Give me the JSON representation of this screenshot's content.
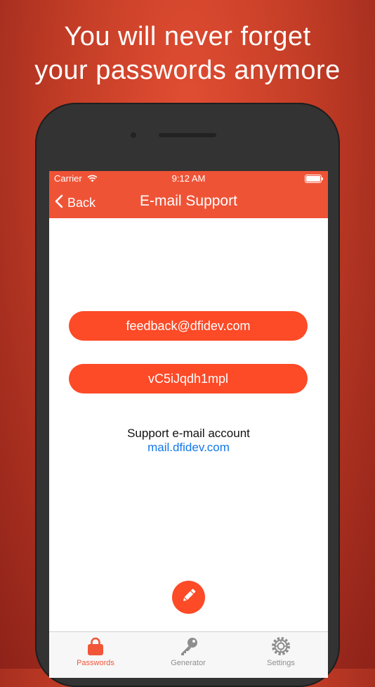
{
  "headline": {
    "line1": "You will never forget",
    "line2": "your passwords anymore"
  },
  "status_bar": {
    "carrier": "Carrier",
    "time": "9:12 AM"
  },
  "nav": {
    "back_label": "Back",
    "title": "E-mail Support"
  },
  "buttons": {
    "email": "feedback@dfidev.com",
    "password": "vC5iJqdh1mpl"
  },
  "support": {
    "label": "Support e-mail account",
    "link": "mail.dfidev.com"
  },
  "tabs": [
    {
      "label": "Passwords",
      "icon": "lock-icon",
      "active": true
    },
    {
      "label": "Generator",
      "icon": "key-icon",
      "active": false
    },
    {
      "label": "Settings",
      "icon": "gear-icon",
      "active": false
    }
  ],
  "colors": {
    "accent": "#fd4a27",
    "navbar": "#ef5336",
    "link": "#1378e8",
    "tab_active": "#f15638",
    "tab_inactive": "#8e8e8e"
  }
}
